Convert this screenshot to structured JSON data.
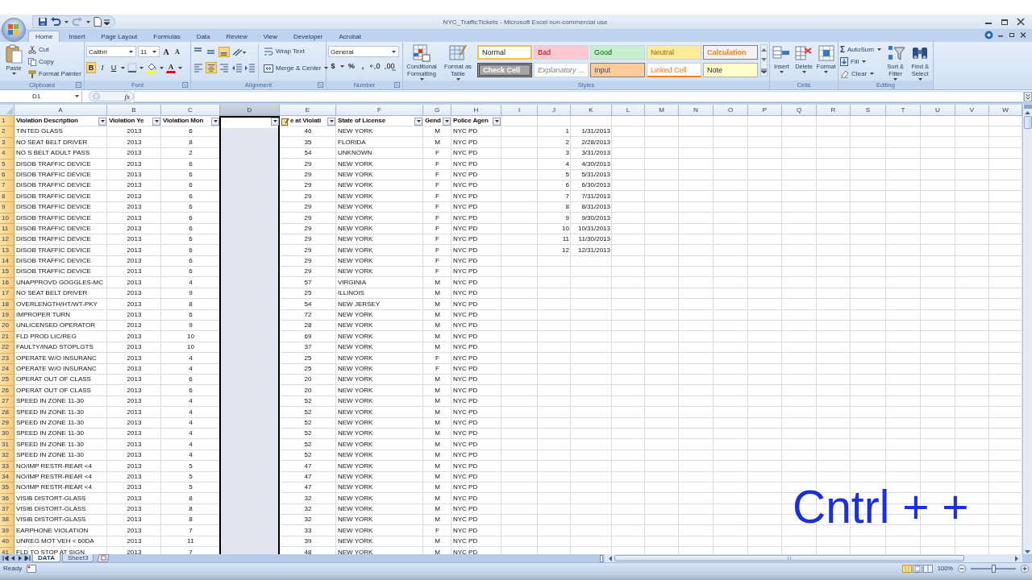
{
  "window": {
    "title": "NYC_TrafficTickets - Microsoft Excel non-commercial use"
  },
  "ribbon_tabs": [
    {
      "label": "Home",
      "selected": true
    },
    {
      "label": "Insert",
      "selected": false
    },
    {
      "label": "Page Layout",
      "selected": false
    },
    {
      "label": "Formulas",
      "selected": false
    },
    {
      "label": "Data",
      "selected": false
    },
    {
      "label": "Review",
      "selected": false
    },
    {
      "label": "View",
      "selected": false
    },
    {
      "label": "Developer",
      "selected": false
    },
    {
      "label": "Acrobat",
      "selected": false
    }
  ],
  "ribbon": {
    "clipboard": {
      "label": "Clipboard",
      "paste": "Paste",
      "cut": "Cut",
      "copy": "Copy",
      "painter": "Format Painter"
    },
    "font": {
      "label": "Font",
      "name": "Calibri",
      "size": "11",
      "grow": "A",
      "shrink": "A",
      "color_letter": "A",
      "styles": [
        {
          "label": "B",
          "kind": "bold",
          "selected": true
        },
        {
          "label": "I",
          "kind": "italic",
          "selected": false
        },
        {
          "label": "U",
          "kind": "underline",
          "selected": false
        }
      ]
    },
    "alignment": {
      "label": "Alignment",
      "vertical": [
        {
          "kind": "top",
          "selected": false
        },
        {
          "kind": "middle",
          "selected": false
        },
        {
          "kind": "bottom",
          "selected": true
        }
      ],
      "horizontal": [
        {
          "kind": "left",
          "selected": false
        },
        {
          "kind": "center",
          "selected": true
        },
        {
          "kind": "right",
          "selected": false
        }
      ],
      "wrap": "Wrap Text",
      "merge": "Merge & Center"
    },
    "number": {
      "label": "Number",
      "format": "General",
      "currency": "$",
      "percent": "%",
      "comma": ","
    },
    "styles": {
      "label": "Styles",
      "conditional": "Conditional Formatting",
      "as_table": "Format as Table",
      "gallery": [
        {
          "label": "Normal",
          "kind": "normal",
          "selected": true
        },
        {
          "label": "Bad",
          "kind": "bad",
          "selected": false
        },
        {
          "label": "Good",
          "kind": "good",
          "selected": false
        },
        {
          "label": "Neutral",
          "kind": "neutral",
          "selected": false
        },
        {
          "label": "Calculation",
          "kind": "calculation",
          "selected": false
        },
        {
          "label": "Check Cell",
          "kind": "check",
          "selected": false
        },
        {
          "label": "Explanatory ...",
          "kind": "explanatory",
          "selected": false
        },
        {
          "label": "Input",
          "kind": "input",
          "selected": false
        },
        {
          "label": "Linked Cell",
          "kind": "linked",
          "selected": false
        },
        {
          "label": "Note",
          "kind": "note",
          "selected": false
        }
      ]
    },
    "cells": {
      "label": "Cells",
      "buttons": [
        {
          "label": "Insert",
          "kind": "insert"
        },
        {
          "label": "Delete",
          "kind": "delete"
        },
        {
          "label": "Format",
          "kind": "format"
        }
      ]
    },
    "editing": {
      "label": "Editing",
      "autosum_symbol": "Σ",
      "autosum": "AutoSum",
      "fill": "Fill",
      "clear": "Clear",
      "sort": "Sort & Filter",
      "find": "Find & Select"
    }
  },
  "formula_bar": {
    "name_box": "D1",
    "function_label": "fx"
  },
  "sheet": {
    "columns": [
      {
        "letter": "A",
        "selected": false
      },
      {
        "letter": "B",
        "selected": false
      },
      {
        "letter": "C",
        "selected": false
      },
      {
        "letter": "D",
        "selected": true
      },
      {
        "letter": "E",
        "selected": false
      },
      {
        "letter": "F",
        "selected": false
      },
      {
        "letter": "G",
        "selected": false
      },
      {
        "letter": "H",
        "selected": false
      },
      {
        "letter": "I",
        "selected": false
      },
      {
        "letter": "J",
        "selected": false
      },
      {
        "letter": "K",
        "selected": false
      },
      {
        "letter": "L",
        "selected": false
      },
      {
        "letter": "M",
        "selected": false
      },
      {
        "letter": "N",
        "selected": false
      },
      {
        "letter": "O",
        "selected": false
      },
      {
        "letter": "P",
        "selected": false
      },
      {
        "letter": "Q",
        "selected": false
      },
      {
        "letter": "R",
        "selected": false
      },
      {
        "letter": "S",
        "selected": false
      },
      {
        "letter": "T",
        "selected": false
      },
      {
        "letter": "U",
        "selected": false
      },
      {
        "letter": "V",
        "selected": false
      },
      {
        "letter": "W",
        "selected": false
      }
    ],
    "header_row": {
      "row": "1",
      "cells": {
        "A": {
          "text": "Violation Description",
          "filter": true
        },
        "B": {
          "text": "Violation Ye",
          "filter": true
        },
        "C": {
          "text": "Violation Mon",
          "filter": true
        },
        "D": {
          "filter": true
        },
        "E": {
          "text": "e at Violati",
          "filter": true,
          "paste_options": true
        },
        "F": {
          "text": "State of License",
          "filter": true
        },
        "G": {
          "text": "Gend",
          "filter": true
        },
        "H": {
          "text": "Police Agen",
          "filter": true
        }
      }
    },
    "rows": [
      {
        "row": "2",
        "A": "TINTED GLASS",
        "B": "2013",
        "C": "6",
        "E": "46",
        "F": "NEW YORK",
        "G": "M",
        "H": "NYC PD",
        "J": "1",
        "K": "1/31/2013"
      },
      {
        "row": "3",
        "A": "NO SEAT BELT DRIVER",
        "B": "2013",
        "C": "8",
        "E": "35",
        "F": "FLORIDA",
        "G": "M",
        "H": "NYC PD",
        "J": "2",
        "K": "2/28/2013"
      },
      {
        "row": "4",
        "A": "NO S BELT ADULT PASS",
        "B": "2013",
        "C": "2",
        "E": "54",
        "F": "UNKNOWN",
        "G": "F",
        "H": "NYC PD",
        "J": "3",
        "K": "3/31/2013"
      },
      {
        "row": "5",
        "A": "DISOB TRAFFIC DEVICE",
        "B": "2013",
        "C": "6",
        "E": "29",
        "F": "NEW YORK",
        "G": "F",
        "H": "NYC PD",
        "J": "4",
        "K": "4/30/2013"
      },
      {
        "row": "6",
        "A": "DISOB TRAFFIC DEVICE",
        "B": "2013",
        "C": "6",
        "E": "29",
        "F": "NEW YORK",
        "G": "F",
        "H": "NYC PD",
        "J": "5",
        "K": "5/31/2013"
      },
      {
        "row": "7",
        "A": "DISOB TRAFFIC DEVICE",
        "B": "2013",
        "C": "6",
        "E": "29",
        "F": "NEW YORK",
        "G": "F",
        "H": "NYC PD",
        "J": "6",
        "K": "6/30/2013"
      },
      {
        "row": "8",
        "A": "DISOB TRAFFIC DEVICE",
        "B": "2013",
        "C": "6",
        "E": "29",
        "F": "NEW YORK",
        "G": "F",
        "H": "NYC PD",
        "J": "7",
        "K": "7/31/2013"
      },
      {
        "row": "9",
        "A": "DISOB TRAFFIC DEVICE",
        "B": "2013",
        "C": "6",
        "E": "29",
        "F": "NEW YORK",
        "G": "F",
        "H": "NYC PD",
        "J": "8",
        "K": "8/31/2013"
      },
      {
        "row": "10",
        "A": "DISOB TRAFFIC DEVICE",
        "B": "2013",
        "C": "6",
        "E": "29",
        "F": "NEW YORK",
        "G": "F",
        "H": "NYC PD",
        "J": "9",
        "K": "9/30/2013"
      },
      {
        "row": "11",
        "A": "DISOB TRAFFIC DEVICE",
        "B": "2013",
        "C": "6",
        "E": "29",
        "F": "NEW YORK",
        "G": "F",
        "H": "NYC PD",
        "J": "10",
        "K": "10/31/2013"
      },
      {
        "row": "12",
        "A": "DISOB TRAFFIC DEVICE",
        "B": "2013",
        "C": "6",
        "E": "29",
        "F": "NEW YORK",
        "G": "F",
        "H": "NYC PD",
        "J": "11",
        "K": "11/30/2013"
      },
      {
        "row": "13",
        "A": "DISOB TRAFFIC DEVICE",
        "B": "2013",
        "C": "6",
        "E": "29",
        "F": "NEW YORK",
        "G": "F",
        "H": "NYC PD",
        "J": "12",
        "K": "12/31/2013"
      },
      {
        "row": "14",
        "A": "DISOB TRAFFIC DEVICE",
        "B": "2013",
        "C": "6",
        "E": "29",
        "F": "NEW YORK",
        "G": "F",
        "H": "NYC PD"
      },
      {
        "row": "15",
        "A": "DISOB TRAFFIC DEVICE",
        "B": "2013",
        "C": "6",
        "E": "29",
        "F": "NEW YORK",
        "G": "F",
        "H": "NYC PD"
      },
      {
        "row": "16",
        "A": "UNAPPROVD GOGGLES-MC",
        "B": "2013",
        "C": "4",
        "E": "57",
        "F": "VIRGINIA",
        "G": "M",
        "H": "NYC PD"
      },
      {
        "row": "17",
        "A": "NO SEAT BELT DRIVER",
        "B": "2013",
        "C": "9",
        "E": "25",
        "F": "ILLINOIS",
        "G": "M",
        "H": "NYC PD"
      },
      {
        "row": "18",
        "A": "OVERLENGTH/HT/WT-PKY",
        "B": "2013",
        "C": "8",
        "E": "54",
        "F": "NEW JERSEY",
        "G": "M",
        "H": "NYC PD"
      },
      {
        "row": "19",
        "A": "IMPROPER TURN",
        "B": "2013",
        "C": "6",
        "E": "72",
        "F": "NEW YORK",
        "G": "M",
        "H": "NYC PD"
      },
      {
        "row": "20",
        "A": "UNLICENSED OPERATOR",
        "B": "2013",
        "C": "9",
        "E": "28",
        "F": "NEW YORK",
        "G": "M",
        "H": "NYC PD"
      },
      {
        "row": "21",
        "A": "FLD PROD LIC/REG",
        "B": "2013",
        "C": "10",
        "E": "69",
        "F": "NEW YORK",
        "G": "M",
        "H": "NYC PD"
      },
      {
        "row": "22",
        "A": "FAULTY/INAD STOPLGTS",
        "B": "2013",
        "C": "10",
        "E": "37",
        "F": "NEW YORK",
        "G": "M",
        "H": "NYC PD"
      },
      {
        "row": "23",
        "A": "OPERATE W/O INSURANC",
        "B": "2013",
        "C": "4",
        "E": "25",
        "F": "NEW YORK",
        "G": "F",
        "H": "NYC PD"
      },
      {
        "row": "24",
        "A": "OPERATE W/O INSURANC",
        "B": "2013",
        "C": "4",
        "E": "25",
        "F": "NEW YORK",
        "G": "F",
        "H": "NYC PD"
      },
      {
        "row": "25",
        "A": "OPERAT OUT OF CLASS",
        "B": "2013",
        "C": "6",
        "E": "20",
        "F": "NEW YORK",
        "G": "M",
        "H": "NYC PD"
      },
      {
        "row": "26",
        "A": "OPERAT OUT OF CLASS",
        "B": "2013",
        "C": "6",
        "E": "20",
        "F": "NEW YORK",
        "G": "M",
        "H": "NYC PD"
      },
      {
        "row": "27",
        "A": "SPEED IN ZONE 11-30",
        "B": "2013",
        "C": "4",
        "E": "52",
        "F": "NEW YORK",
        "G": "M",
        "H": "NYC PD"
      },
      {
        "row": "28",
        "A": "SPEED IN ZONE 11-30",
        "B": "2013",
        "C": "4",
        "E": "52",
        "F": "NEW YORK",
        "G": "M",
        "H": "NYC PD"
      },
      {
        "row": "29",
        "A": "SPEED IN ZONE 11-30",
        "B": "2013",
        "C": "4",
        "E": "52",
        "F": "NEW YORK",
        "G": "M",
        "H": "NYC PD"
      },
      {
        "row": "30",
        "A": "SPEED IN ZONE 11-30",
        "B": "2013",
        "C": "4",
        "E": "52",
        "F": "NEW YORK",
        "G": "M",
        "H": "NYC PD"
      },
      {
        "row": "31",
        "A": "SPEED IN ZONE 11-30",
        "B": "2013",
        "C": "4",
        "E": "52",
        "F": "NEW YORK",
        "G": "M",
        "H": "NYC PD"
      },
      {
        "row": "32",
        "A": "SPEED IN ZONE 11-30",
        "B": "2013",
        "C": "4",
        "E": "52",
        "F": "NEW YORK",
        "G": "M",
        "H": "NYC PD"
      },
      {
        "row": "33",
        "A": "NO/IMP RESTR-REAR <4",
        "B": "2013",
        "C": "5",
        "E": "47",
        "F": "NEW YORK",
        "G": "M",
        "H": "NYC PD"
      },
      {
        "row": "34",
        "A": "NO/IMP RESTR-REAR <4",
        "B": "2013",
        "C": "5",
        "E": "47",
        "F": "NEW YORK",
        "G": "M",
        "H": "NYC PD"
      },
      {
        "row": "35",
        "A": "NO/IMP RESTR-REAR <4",
        "B": "2013",
        "C": "5",
        "E": "47",
        "F": "NEW YORK",
        "G": "M",
        "H": "NYC PD"
      },
      {
        "row": "36",
        "A": "VISIB DISTORT-GLASS",
        "B": "2013",
        "C": "8",
        "E": "32",
        "F": "NEW YORK",
        "G": "M",
        "H": "NYC PD"
      },
      {
        "row": "37",
        "A": "VISIB DISTORT-GLASS",
        "B": "2013",
        "C": "8",
        "E": "32",
        "F": "NEW YORK",
        "G": "M",
        "H": "NYC PD"
      },
      {
        "row": "38",
        "A": "VISIB DISTORT-GLASS",
        "B": "2013",
        "C": "8",
        "E": "32",
        "F": "NEW YORK",
        "G": "M",
        "H": "NYC PD"
      },
      {
        "row": "39",
        "A": "EARPHONE VIOLATION",
        "B": "2013",
        "C": "7",
        "E": "33",
        "F": "NEW YORK",
        "G": "F",
        "H": "NYC PD"
      },
      {
        "row": "40",
        "A": "UNREG MOT VEH < 60DA",
        "B": "2013",
        "C": "11",
        "E": "39",
        "F": "NEW YORK",
        "G": "M",
        "H": "NYC PD"
      },
      {
        "row": "41",
        "A": "FLD TO STOP AT SIGN",
        "B": "2013",
        "C": "7",
        "E": "48",
        "F": "NEW YORK",
        "G": "M",
        "H": "NYC PD"
      }
    ]
  },
  "sheet_tabs": [
    {
      "label": "DATA",
      "selected": true
    },
    {
      "label": "Sheet3",
      "selected": false
    }
  ],
  "status_bar": {
    "mode": "Ready",
    "zoom": "100%",
    "zoom_slider": {
      "level": 0.5
    }
  },
  "overlay_caption": "Cntrl + +"
}
